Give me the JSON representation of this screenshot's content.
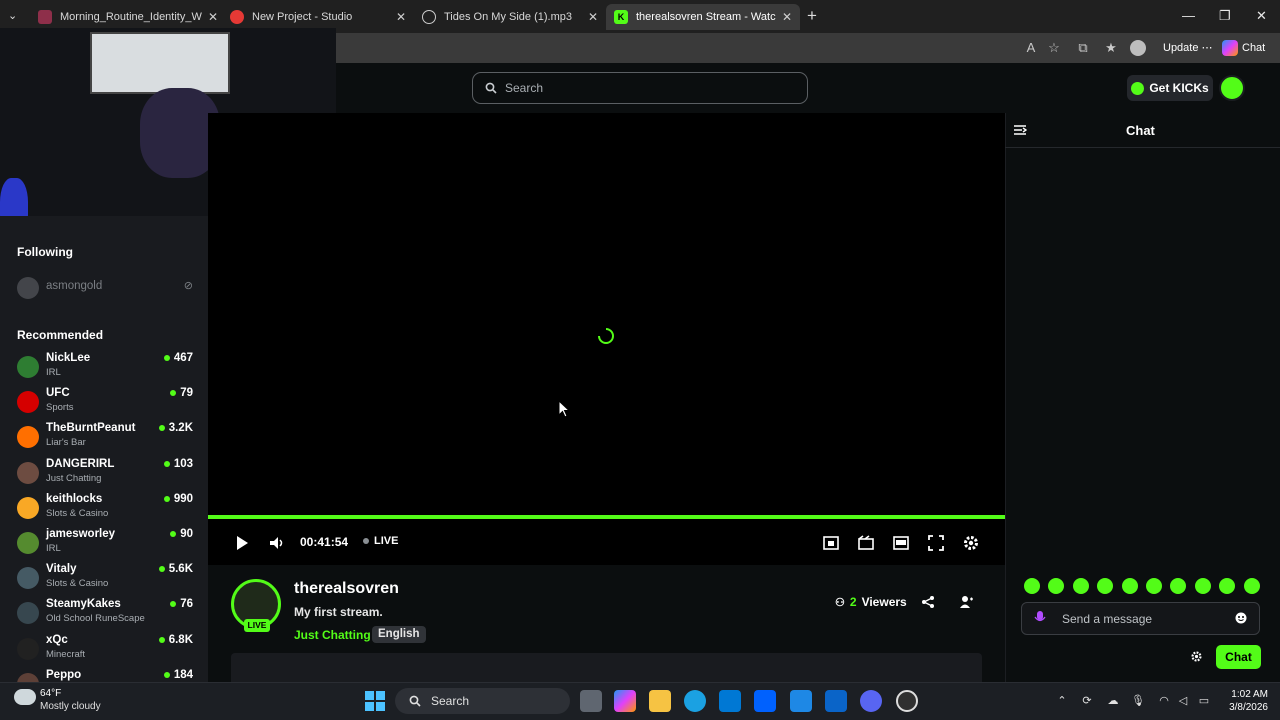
{
  "browser": {
    "tabs": [
      {
        "title": "Morning_Routine_Identity_Wallpaper",
        "active": false
      },
      {
        "title": "New Project - Studio",
        "active": false
      },
      {
        "title": "Tides On My Side (1).mp3",
        "active": false
      },
      {
        "title": "therealsovren Stream - Watch Live",
        "active": true
      }
    ],
    "update_label": "Update",
    "chat_label": "Chat"
  },
  "header": {
    "search_placeholder": "Search",
    "get_kicks_label": "Get KICKs"
  },
  "sidebar": {
    "following_title": "Following",
    "following": [
      {
        "name": "asmongold",
        "offline": true
      }
    ],
    "recommended_title": "Recommended",
    "recommended": [
      {
        "name": "NickLee",
        "category": "IRL",
        "viewers": "467",
        "color": "#2e7d32"
      },
      {
        "name": "UFC",
        "category": "Sports",
        "viewers": "79",
        "color": "#d50000"
      },
      {
        "name": "TheBurntPeanut",
        "category": "Liar's Bar",
        "viewers": "3.2K",
        "color": "#ff6f00"
      },
      {
        "name": "DANGERIRL",
        "category": "Just Chatting",
        "viewers": "103",
        "color": "#6d4c41"
      },
      {
        "name": "keithlocks",
        "category": "Slots & Casino",
        "viewers": "990",
        "color": "#f9a825"
      },
      {
        "name": "jamesworley",
        "category": "IRL",
        "viewers": "90",
        "color": "#558b2f"
      },
      {
        "name": "Vitaly",
        "category": "Slots & Casino",
        "viewers": "5.6K",
        "color": "#455a64"
      },
      {
        "name": "SteamyKakes",
        "category": "Old School RuneScape",
        "viewers": "76",
        "color": "#37474f"
      },
      {
        "name": "xQc",
        "category": "Minecraft",
        "viewers": "6.8K",
        "color": "#212121"
      },
      {
        "name": "Peppo",
        "category": "",
        "viewers": "184",
        "color": "#5d4037"
      }
    ]
  },
  "player": {
    "time": "00:41:54",
    "live_label": "LIVE",
    "progress": 1.0
  },
  "stream": {
    "streamer": "therealsovren",
    "live_badge": "LIVE",
    "title": "My first stream.",
    "category": "Just Chatting",
    "language": "English",
    "viewer_count": "2",
    "viewers_label": "Viewers"
  },
  "chat": {
    "title": "Chat",
    "message_placeholder": "Send a message",
    "send_label": "Chat"
  },
  "taskbar": {
    "weather_temp": "64°F",
    "weather_desc": "Mostly cloudy",
    "search_label": "Search",
    "time": "1:02 AM",
    "date": "3/8/2026"
  },
  "colors": {
    "accent": "#53fc18",
    "background": "#0b0e0f",
    "sidebar": "#191b1f"
  }
}
